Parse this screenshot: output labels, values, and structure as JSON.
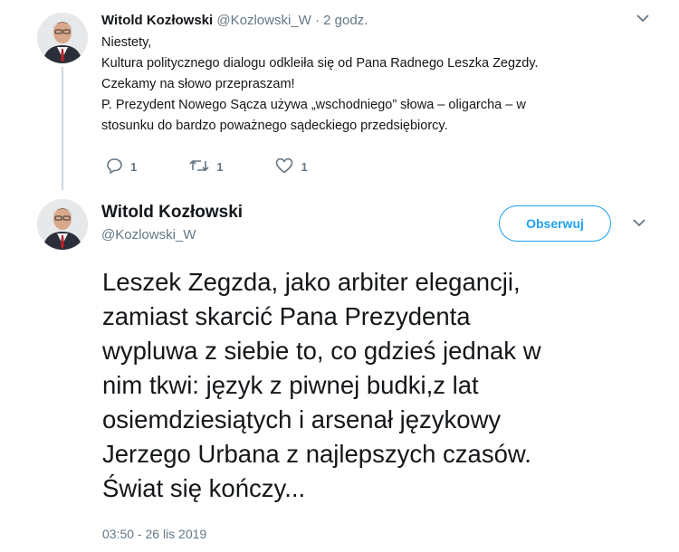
{
  "tweet1": {
    "author_name": "Witold Kozłowski",
    "handle": "@Kozlowski_W",
    "separator": "·",
    "time": "2 godz.",
    "lines": [
      "Niestety,",
      "Kultura politycznego dialogu odkleiła się od Pana Radnego Leszka Zegzdy.",
      "Czekamy na słowo przepraszam!",
      "P. Prezydent Nowego Sącza używa „wschodniego” słowa – oligarcha – w",
      "stosunku do bardzo poważnego sądeckiego przedsiębiorcy."
    ],
    "actions": {
      "reply_count": "1",
      "retweet_count": "1",
      "like_count": "1"
    }
  },
  "tweet2": {
    "author_name": "Witold Kozłowski",
    "handle": "@Kozlowski_W",
    "follow_label": "Obserwuj",
    "lines": [
      "Leszek Zegzda, jako arbiter elegancji,",
      "zamiast skarcić Pana Prezydenta",
      "wypluwa z siebie to, co gdzieś jednak w",
      "nim tkwi: język z piwnej budki,z lat",
      "osiemdziesiątych i arsenał językowy",
      "Jerzego Urbana z najlepszych czasów.",
      "Świat się kończy..."
    ],
    "timestamp": "03:50 - 26 lis 2019"
  },
  "colors": {
    "accent": "#1da1f2",
    "secondary_text": "#657786",
    "thread_line": "#ccd6dd"
  },
  "icons": [
    "avatar-photo",
    "chevron-down-icon",
    "reply-icon",
    "retweet-icon",
    "like-icon"
  ]
}
